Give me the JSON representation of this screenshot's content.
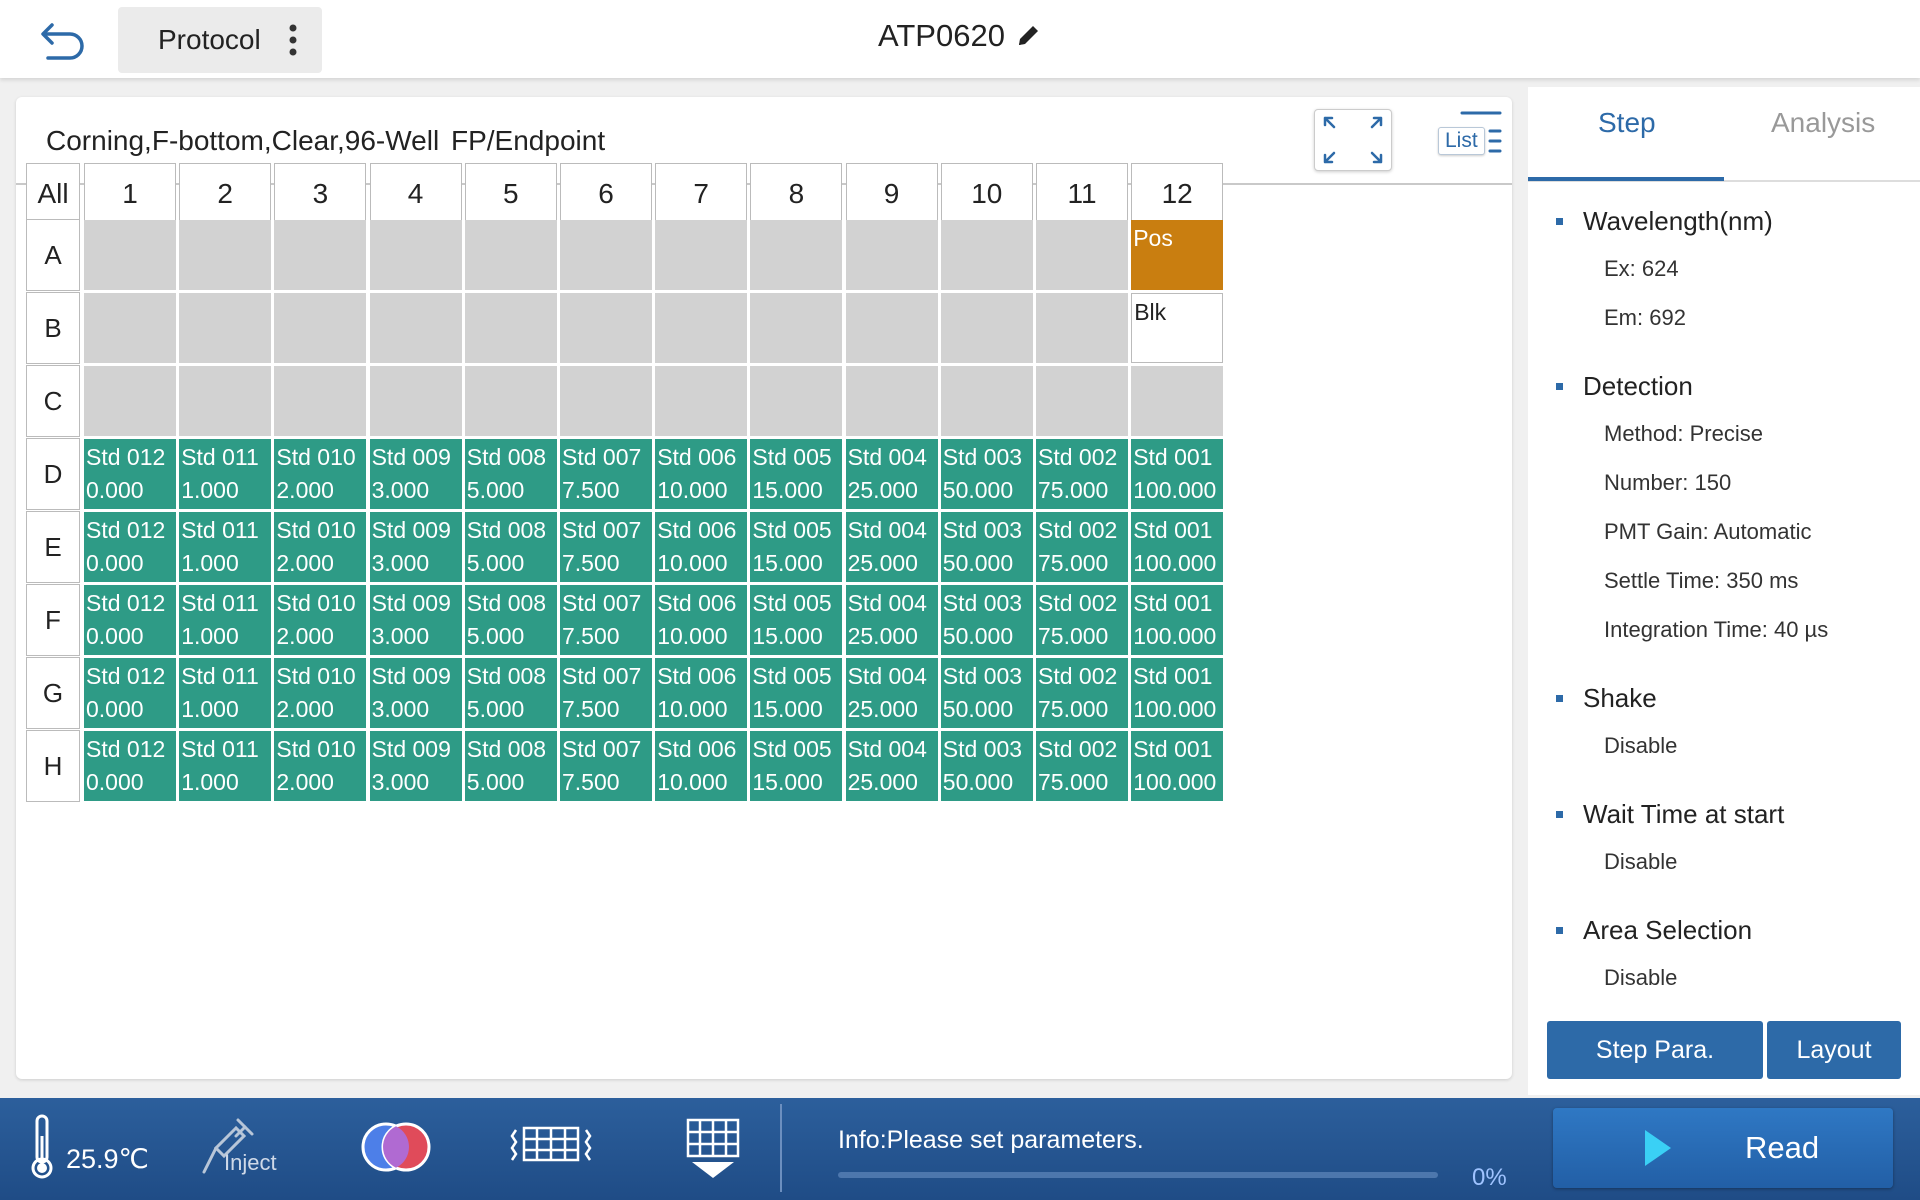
{
  "header": {
    "protocol_label": "Protocol",
    "title": "ATP0620"
  },
  "plate": {
    "plate_type": "Corning,F-bottom,Clear,96-Well",
    "read_mode": "FP/Endpoint",
    "list_label": "List",
    "all_label": "All",
    "columns": [
      "1",
      "2",
      "3",
      "4",
      "5",
      "6",
      "7",
      "8",
      "9",
      "10",
      "11",
      "12"
    ],
    "rows": [
      "A",
      "B",
      "C",
      "D",
      "E",
      "F",
      "G",
      "H"
    ],
    "std_names": [
      "Std 012",
      "Std 011",
      "Std 010",
      "Std 009",
      "Std 008",
      "Std 007",
      "Std 006",
      "Std 005",
      "Std 004",
      "Std 003",
      "Std 002",
      "Std 001"
    ],
    "std_values": [
      "0.000",
      "1.000",
      "2.000",
      "3.000",
      "5.000",
      "7.500",
      "10.000",
      "15.000",
      "25.000",
      "50.000",
      "75.000",
      "100.000"
    ],
    "special": {
      "pos_label": "Pos",
      "blk_label": "Blk"
    },
    "colors": {
      "standard": "#2e9b86",
      "positive": "#c97e10",
      "empty": "#d2d2d2"
    }
  },
  "right_panel": {
    "tabs": [
      "Step",
      "Analysis"
    ],
    "active_tab": "Step",
    "sections": [
      {
        "title": "Wavelength(nm)",
        "items": [
          "Ex: 624",
          "Em: 692"
        ]
      },
      {
        "title": "Detection",
        "items": [
          "Method: Precise",
          "Number: 150",
          "PMT Gain: Automatic",
          "Settle Time: 350 ms",
          "Integration Time: 40 µs"
        ]
      },
      {
        "title": "Shake",
        "items": [
          "Disable"
        ]
      },
      {
        "title": "Wait Time at start",
        "items": [
          "Disable"
        ]
      },
      {
        "title": "Area Selection",
        "items": [
          "Disable"
        ]
      }
    ],
    "step_para_label": "Step Para.",
    "layout_label": "Layout"
  },
  "footer": {
    "temperature": "25.9℃",
    "inject_label": "Inject",
    "info": "Info:Please set parameters.",
    "progress_percent": "0%",
    "read_label": "Read"
  }
}
